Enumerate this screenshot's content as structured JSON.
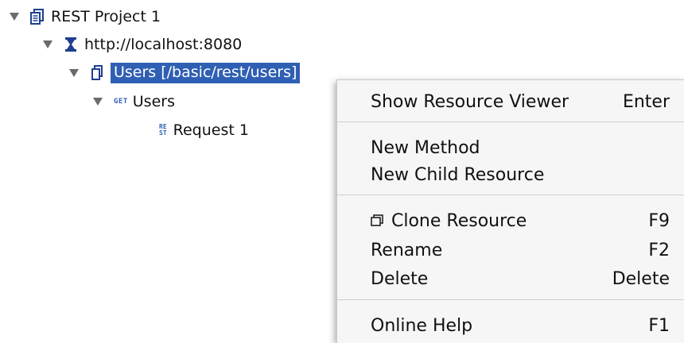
{
  "tree": {
    "project": {
      "label": "REST Project 1"
    },
    "service": {
      "label": "http://localhost:8080"
    },
    "resource": {
      "label": "Users [/basic/rest/users]"
    },
    "method": {
      "tag": "GET",
      "label": "Users"
    },
    "request": {
      "badge_top": "RE",
      "badge_bottom": "ST",
      "label": "Request 1"
    }
  },
  "context_menu": {
    "show_resource_viewer": {
      "label": "Show Resource Viewer",
      "shortcut": "Enter"
    },
    "new_method": {
      "label": "New Method"
    },
    "new_child_resource": {
      "label": "New Child Resource"
    },
    "clone_resource": {
      "label": "Clone Resource",
      "shortcut": "F9"
    },
    "rename": {
      "label": "Rename",
      "shortcut": "F2"
    },
    "delete": {
      "label": "Delete",
      "shortcut": "Delete"
    },
    "online_help": {
      "label": "Online Help",
      "shortcut": "F1"
    }
  },
  "colors": {
    "selection": "#2f5fb3",
    "menu_background": "#f6f6f6",
    "icon_blue": "#1f3f8f"
  }
}
